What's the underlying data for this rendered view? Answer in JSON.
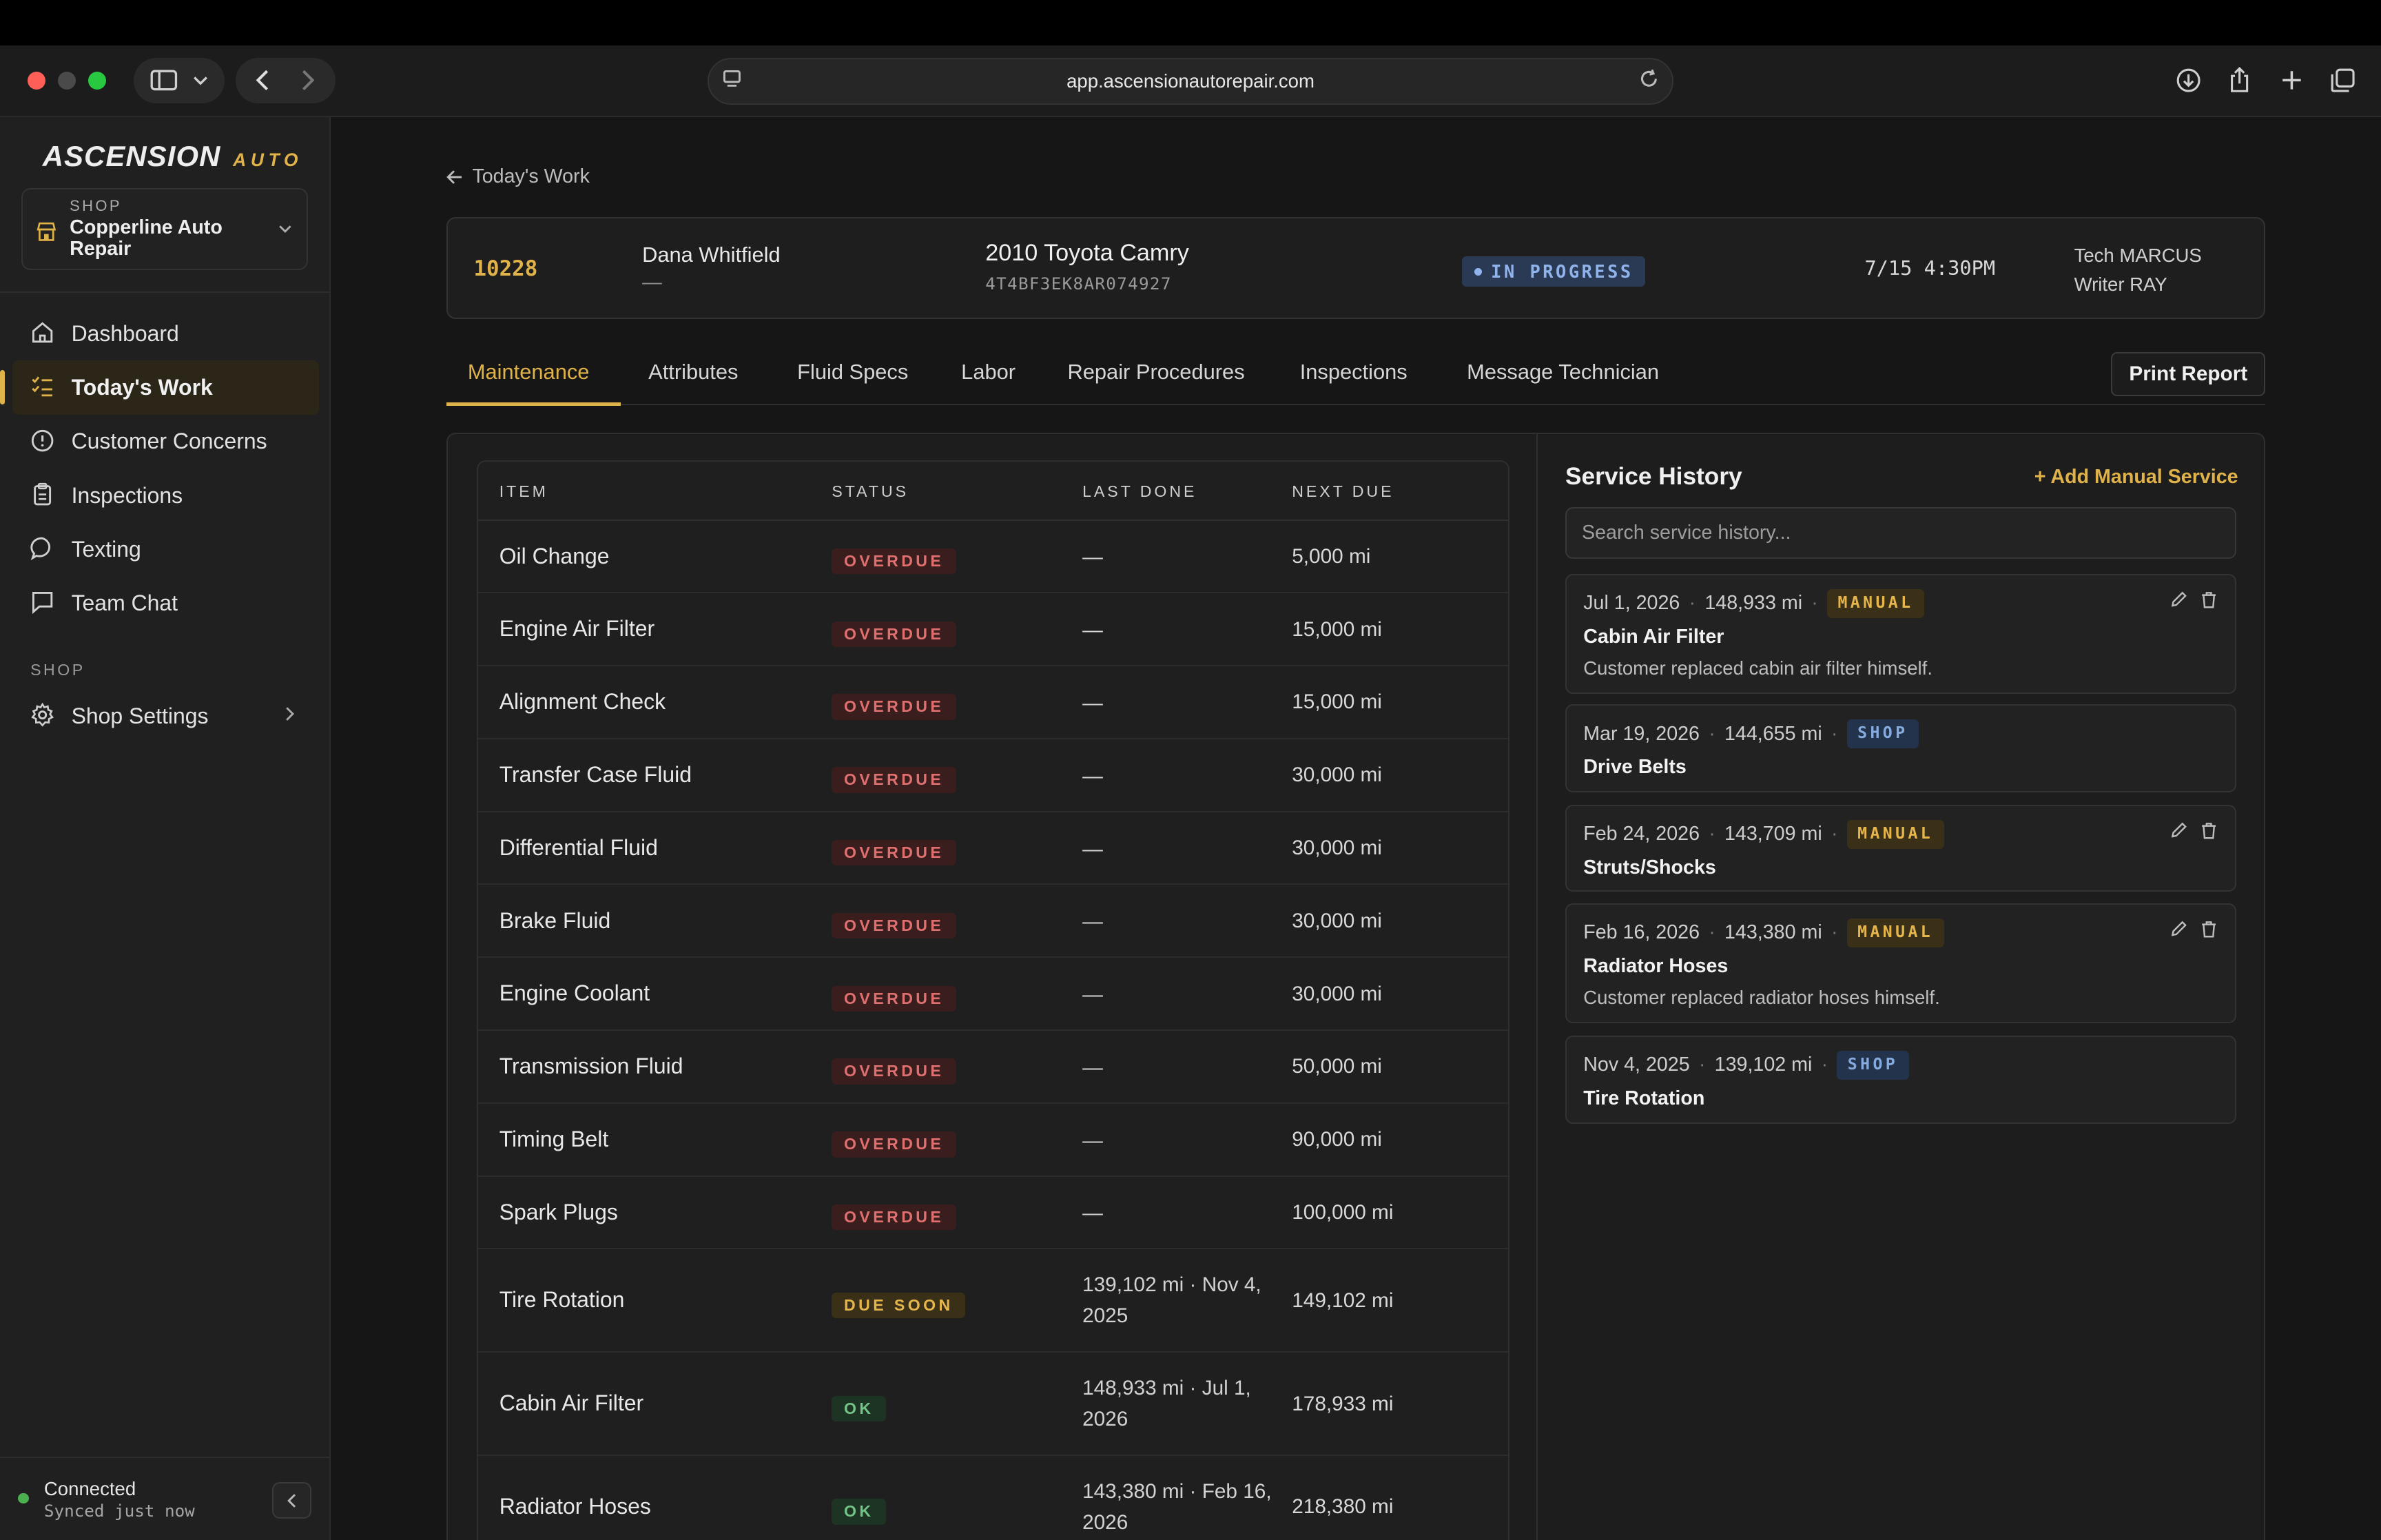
{
  "browser": {
    "url": "app.ascensionautorepair.com"
  },
  "sidebar": {
    "logo_main": "ASCENSION",
    "logo_sub": "AUTO",
    "shop_label": "SHOP",
    "shop_name": "Copperline Auto Repair",
    "nav": [
      {
        "label": "Dashboard",
        "icon": "home-icon"
      },
      {
        "label": "Today's Work",
        "icon": "checklist-icon",
        "active": true
      },
      {
        "label": "Customer Concerns",
        "icon": "alert-circle-icon"
      },
      {
        "label": "Inspections",
        "icon": "clipboard-icon"
      },
      {
        "label": "Texting",
        "icon": "message-circle-icon"
      },
      {
        "label": "Team Chat",
        "icon": "chat-square-icon"
      }
    ],
    "section_label": "SHOP",
    "shop_settings_label": "Shop Settings",
    "status": "Connected",
    "status_sub": "Synced just now"
  },
  "main": {
    "back_label": "Today's Work",
    "work_order": {
      "number": "10228",
      "customer": "Dana Whitfield",
      "customer_sub": "—",
      "vehicle": "2010 Toyota Camry",
      "vin": "4T4BF3EK8AR074927",
      "status": "IN PROGRESS",
      "time": "7/15 4:30PM",
      "tech": "Tech MARCUS",
      "writer": "Writer RAY"
    },
    "tabs": [
      "Maintenance",
      "Attributes",
      "Fluid Specs",
      "Labor",
      "Repair Procedures",
      "Inspections",
      "Message Technician"
    ],
    "print_label": "Print Report",
    "table": {
      "headers": [
        "ITEM",
        "STATUS",
        "LAST DONE",
        "NEXT DUE"
      ],
      "rows": [
        {
          "item": "Oil Change",
          "status": "OVERDUE",
          "last": "—",
          "next": "5,000 mi"
        },
        {
          "item": "Engine Air Filter",
          "status": "OVERDUE",
          "last": "—",
          "next": "15,000 mi"
        },
        {
          "item": "Alignment Check",
          "status": "OVERDUE",
          "last": "—",
          "next": "15,000 mi"
        },
        {
          "item": "Transfer Case Fluid",
          "status": "OVERDUE",
          "last": "—",
          "next": "30,000 mi"
        },
        {
          "item": "Differential Fluid",
          "status": "OVERDUE",
          "last": "—",
          "next": "30,000 mi"
        },
        {
          "item": "Brake Fluid",
          "status": "OVERDUE",
          "last": "—",
          "next": "30,000 mi"
        },
        {
          "item": "Engine Coolant",
          "status": "OVERDUE",
          "last": "—",
          "next": "30,000 mi"
        },
        {
          "item": "Transmission Fluid",
          "status": "OVERDUE",
          "last": "—",
          "next": "50,000 mi"
        },
        {
          "item": "Timing Belt",
          "status": "OVERDUE",
          "last": "—",
          "next": "90,000 mi"
        },
        {
          "item": "Spark Plugs",
          "status": "OVERDUE",
          "last": "—",
          "next": "100,000 mi"
        },
        {
          "item": "Tire Rotation",
          "status": "DUE SOON",
          "last_1": "139,102 mi · Nov 4,",
          "last_2": "2025",
          "next": "149,102 mi"
        },
        {
          "item": "Cabin Air Filter",
          "status": "OK",
          "last_1": "148,933 mi · Jul 1,",
          "last_2": "2026",
          "next": "178,933 mi"
        },
        {
          "item": "Radiator Hoses",
          "status": "OK",
          "last_1": "143,380 mi · Feb 16,",
          "last_2": "2026",
          "next": "218,380 mi"
        }
      ]
    },
    "history": {
      "title": "Service History",
      "add_label": "+ Add Manual Service",
      "search_placeholder": "Search service history...",
      "entries": [
        {
          "date": "Jul 1, 2026",
          "miles": "148,933 mi",
          "source": "MANUAL",
          "name": "Cabin Air Filter",
          "note": "Customer replaced cabin air filter himself."
        },
        {
          "date": "Mar 19, 2026",
          "miles": "144,655 mi",
          "source": "SHOP",
          "name": "Drive Belts"
        },
        {
          "date": "Feb 24, 2026",
          "miles": "143,709 mi",
          "source": "MANUAL",
          "name": "Struts/Shocks"
        },
        {
          "date": "Feb 16, 2026",
          "miles": "143,380 mi",
          "source": "MANUAL",
          "name": "Radiator Hoses",
          "note": "Customer replaced radiator hoses himself."
        },
        {
          "date": "Nov 4, 2025",
          "miles": "139,102 mi",
          "source": "SHOP",
          "name": "Tire Rotation"
        }
      ]
    }
  },
  "colors": {
    "accent": "#e0b24a",
    "overdue": "#e07070",
    "due_soon": "#e6b64d",
    "ok": "#73c485",
    "status_blue": "#8fb3ea"
  }
}
